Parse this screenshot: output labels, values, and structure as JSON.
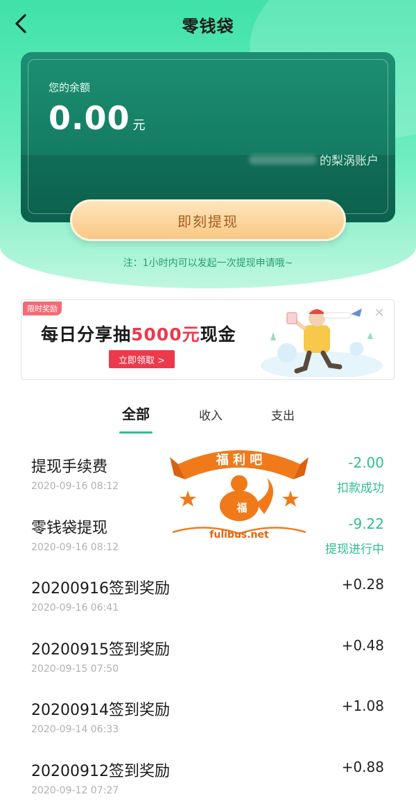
{
  "nav": {
    "title": "零钱袋"
  },
  "balance": {
    "label": "您的余额",
    "amount": "0.00",
    "unit": "元",
    "account_suffix": "的梨涡账户"
  },
  "withdraw_button": "即刻提现",
  "note": "注：1小时内可以发起一次提现申请哦~",
  "banner": {
    "tag": "限时奖励",
    "headline_pre": "每日分享抽",
    "headline_highlight": "5000元",
    "headline_post": "现金",
    "cta": "立即领取 >",
    "close": "✕"
  },
  "tabs": [
    {
      "label": "全部",
      "active": true
    },
    {
      "label": "收入",
      "active": false
    },
    {
      "label": "支出",
      "active": false
    }
  ],
  "transactions": [
    {
      "title": "提现手续费",
      "date": "2020-09-16 08:12",
      "amount": "-2.00",
      "status": "扣款成功"
    },
    {
      "title": "零钱袋提现",
      "date": "2020-09-16 08:12",
      "amount": "-9.22",
      "status": "提现进行中"
    },
    {
      "title": "20200916签到奖励",
      "date": "2020-09-16 06:41",
      "amount": "+0.28",
      "status": ""
    },
    {
      "title": "20200915签到奖励",
      "date": "2020-09-15 07:50",
      "amount": "+0.48",
      "status": ""
    },
    {
      "title": "20200914签到奖励",
      "date": "2020-09-14 06:33",
      "amount": "+1.08",
      "status": ""
    },
    {
      "title": "20200912签到奖励",
      "date": "2020-09-12 07:27",
      "amount": "+0.88",
      "status": ""
    }
  ],
  "watermark": {
    "top_text": "福 利 吧",
    "center_char": "福",
    "site": "fulibus.net"
  },
  "colors": {
    "accent": "#2fbf8f",
    "card": "#0e6f57",
    "button": "#f9c884",
    "banner_red": "#ec3a4c"
  }
}
